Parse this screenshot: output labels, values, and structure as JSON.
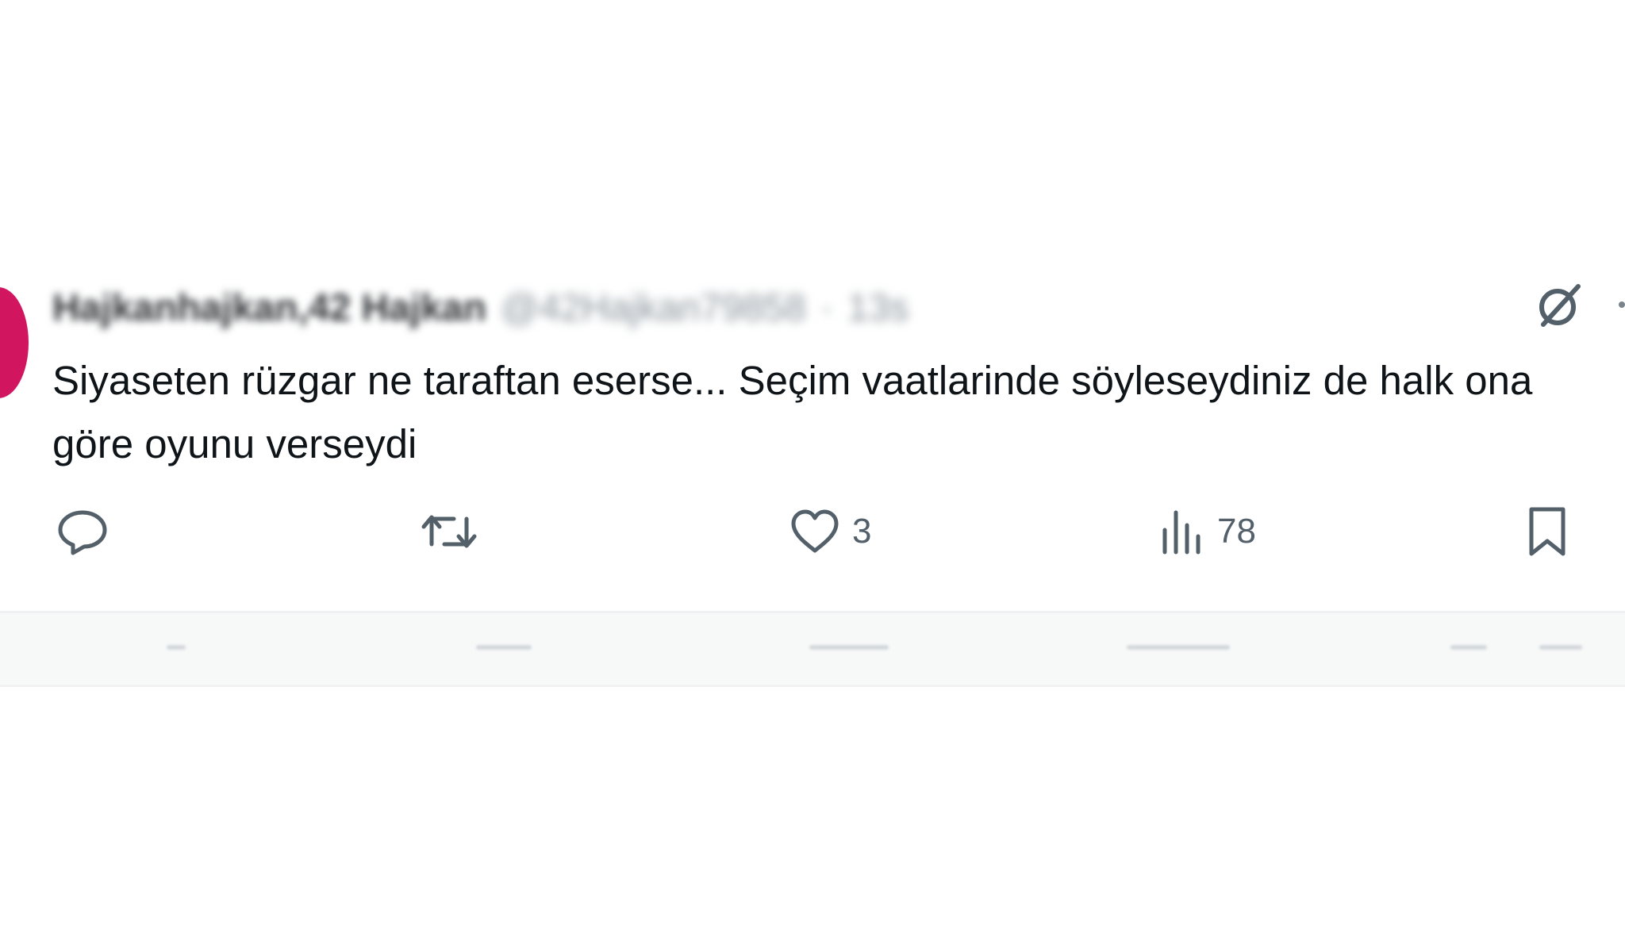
{
  "tweet": {
    "author": {
      "display_name": "Hajkanhajkan,42 Hajkan",
      "handle": "@42Hajkan79858",
      "time": "13s",
      "separator": "·"
    },
    "text": "Siyaseten rüzgar ne taraftan eserse... Seçim vaatlarinde söyleseydiniz de halk ona göre oyunu verseydi",
    "actions": {
      "reply": {
        "icon": "reply-icon",
        "count": ""
      },
      "repost": {
        "icon": "repost-icon",
        "count": ""
      },
      "like": {
        "icon": "heart-icon",
        "count": "3"
      },
      "views": {
        "icon": "views-icon",
        "count": "78"
      },
      "bookmark": {
        "icon": "bookmark-icon"
      }
    },
    "grok_icon": "grok-icon",
    "more_icon": "more-icon"
  },
  "colors": {
    "avatar": "#d1165f",
    "text": "#0f1419",
    "icon": "#53606a",
    "divider": "#eff1f3"
  }
}
